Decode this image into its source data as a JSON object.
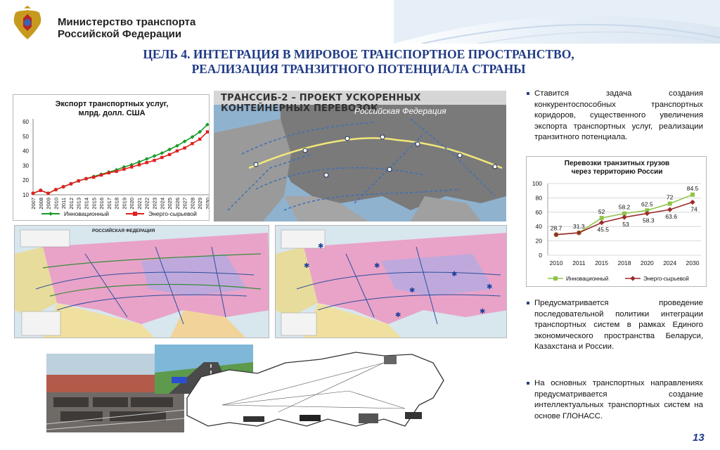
{
  "header": {
    "ministry_line1": "Министерство транспорта",
    "ministry_line2": "Российской Федерации",
    "emblem_icon": "double-headed-eagle-emblem"
  },
  "slide": {
    "title_line1": "ЦЕЛЬ 4. ИНТЕГРАЦИЯ В МИРОВОЕ ТРАНСПОРТНОЕ ПРОСТРАНСТВО,",
    "title_line2": "РЕАЛИЗАЦИЯ ТРАНЗИТНОГО ПОТЕНЦИАЛА СТРАНЫ",
    "page_number": "13",
    "title_color": "#1f3a86"
  },
  "map_top": {
    "title": "ТРАНССИБ-2 – ПРОЕКТ УСКОРЕННЫХ КОНТЕЙНЕРНЫХ ПЕРЕВОЗОК",
    "region_label": "Российская Федерация"
  },
  "map_left": {
    "title": "РОССИЙСКАЯ ФЕДЕРАЦИЯ"
  },
  "bullets": {
    "item1": "Ставится задача создания конкурентоспособных транспортных коридоров, существенного увеличения экспорта транспортных услуг, реализации транзитного потенциала.",
    "item2": "Предусматривается проведение последовательной политики интеграции транспортных систем в рамках Единого экономического пространства Беларуси, Казахстана и России.",
    "item3": "На основных транспортных направлениях предусматривается создание интеллектуальных транспортных систем на основе ГЛОНАСС."
  },
  "chart_data": [
    {
      "type": "line",
      "title_line1": "Экспорт транспортных услуг,",
      "title_line2": "млрд. долл. США",
      "x": [
        "2007",
        "2008",
        "2009",
        "2010",
        "2011",
        "2012",
        "2013",
        "2014",
        "2015",
        "2016",
        "2017",
        "2018",
        "2019",
        "2020",
        "2021",
        "2022",
        "2023",
        "2024",
        "2025",
        "2026",
        "2027",
        "2028",
        "2029",
        "2030"
      ],
      "y_ticks": [
        "10",
        "20",
        "30",
        "40",
        "50",
        "60"
      ],
      "ylim": [
        10,
        60
      ],
      "series": [
        {
          "name": "Инновационный",
          "color": "#1a9a2a",
          "values": [
            11,
            13,
            11,
            13.5,
            15.5,
            17.5,
            19.5,
            21,
            22.5,
            24,
            25.5,
            27,
            29,
            30.5,
            32.5,
            34.5,
            36.5,
            38.5,
            41,
            43.5,
            46.5,
            49.5,
            53,
            58
          ]
        },
        {
          "name": "Энерго-сырьевой",
          "color": "#e02020",
          "values": [
            11,
            13,
            11,
            13.5,
            15.5,
            17.5,
            19.5,
            21,
            22,
            23.5,
            25,
            26,
            27.5,
            29,
            30.5,
            32,
            33.5,
            35.5,
            37.5,
            40,
            42,
            45,
            48,
            53
          ]
        }
      ],
      "grid": false,
      "legend": "bottom"
    },
    {
      "type": "line",
      "title_line1": "Перевозки транзитных грузов",
      "title_line2": "через территорию России",
      "x": [
        "2010",
        "2011",
        "2015",
        "2018",
        "2020",
        "2024",
        "2030"
      ],
      "y_ticks": [
        "0",
        "20",
        "40",
        "60",
        "80",
        "100"
      ],
      "ylim": [
        0,
        100
      ],
      "series": [
        {
          "name": "Инновационный",
          "color": "#8fc44a",
          "values": [
            28.7,
            31.3,
            52,
            58.2,
            62.5,
            72,
            84.5
          ],
          "labels": [
            "28.7",
            "31.3",
            "52",
            "58.2",
            "62.5",
            "72",
            "84.5"
          ]
        },
        {
          "name": "Энерго-сырьевой",
          "color": "#9b2c2c",
          "values": [
            28.7,
            31.3,
            45.5,
            53,
            58.3,
            63.6,
            74
          ],
          "labels": [
            "",
            "",
            "45.5",
            "53",
            "58.3",
            "63.6",
            "74"
          ]
        }
      ],
      "grid": true,
      "legend": "bottom"
    }
  ]
}
